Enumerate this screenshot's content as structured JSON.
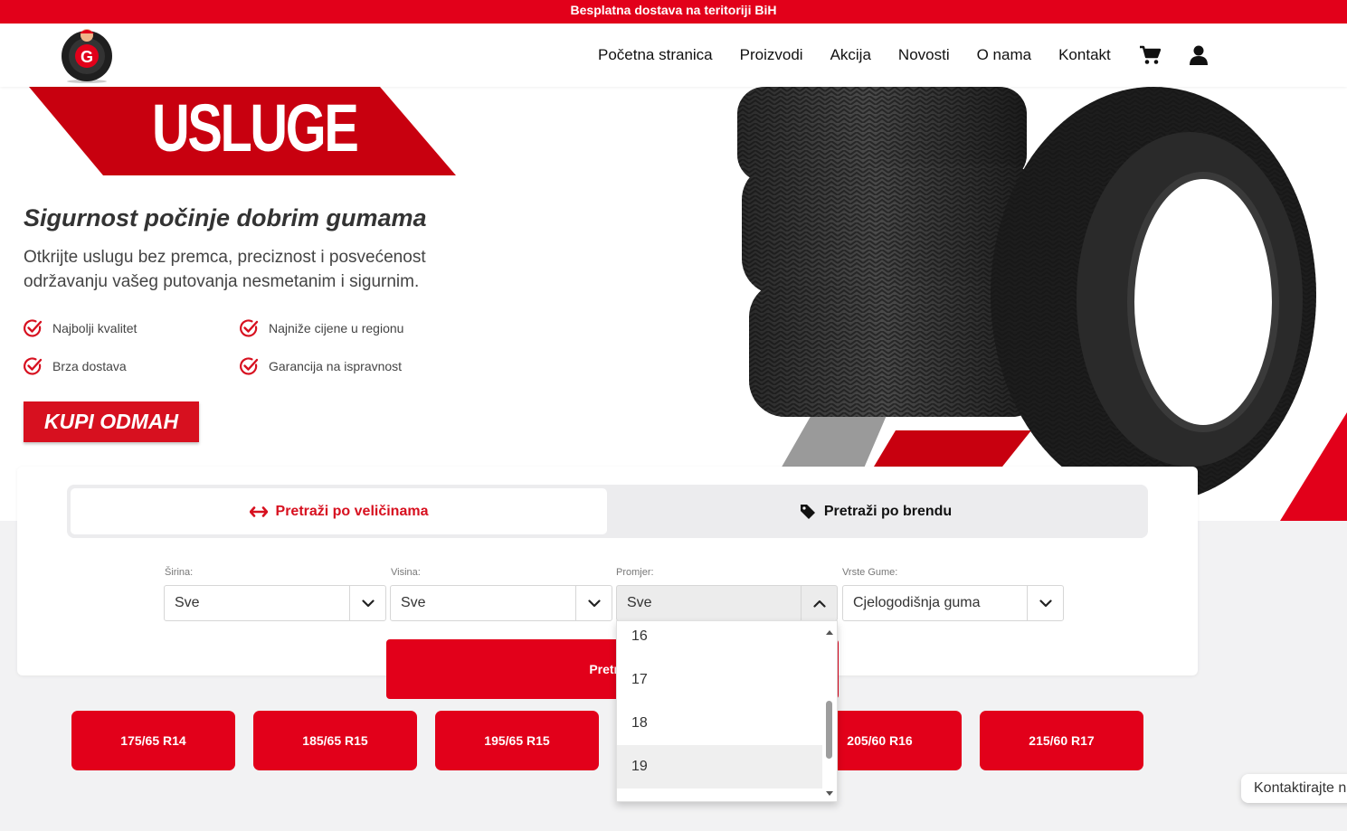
{
  "topbar": {
    "text": "Besplatna dostava na teritoriji BiH"
  },
  "header": {
    "nav": [
      {
        "label": "Početna stranica"
      },
      {
        "label": "Proizvodi"
      },
      {
        "label": "Akcija"
      },
      {
        "label": "Novosti"
      },
      {
        "label": "O nama"
      },
      {
        "label": "Kontakt"
      }
    ],
    "icons": [
      "cart-icon",
      "user-icon"
    ]
  },
  "hero": {
    "banner": "USLUGE",
    "title": "Sigurnost počinje dobrim gumama",
    "description": "Otkrijte uslugu bez premca, preciznost i posvećenost održavanju vašeg putovanja nesmetanim i sigurnim.",
    "features": [
      "Najbolji kvalitet",
      "Najniže cijene u regionu",
      "Brza dostava",
      "Garancija na ispravnost"
    ],
    "cta": "KUPI ODMAH"
  },
  "search": {
    "tabs": [
      {
        "label": "Pretraži po veličinama",
        "active": true
      },
      {
        "label": "Pretraži po brendu",
        "active": false
      }
    ],
    "fields": [
      {
        "label": "Širina:",
        "value": "Sve"
      },
      {
        "label": "Visina:",
        "value": "Sve"
      },
      {
        "label": "Promjer:",
        "value": "Sve",
        "open": true
      },
      {
        "label": "Vrste Gume:",
        "value": "Cjelogodišnja guma"
      }
    ],
    "button_label": "Pretraži",
    "dropdown_options": [
      "16",
      "17",
      "18",
      "19"
    ],
    "dropdown_highlighted": "19"
  },
  "quick_sizes": [
    "175/65 R14",
    "185/65 R15",
    "195/65 R15",
    "205/60 R16",
    "215/60 R17"
  ],
  "chat": {
    "label": "Kontaktirajte nas"
  },
  "colors": {
    "brand_red": "#e2001a",
    "dark_red": "#c8000f"
  }
}
